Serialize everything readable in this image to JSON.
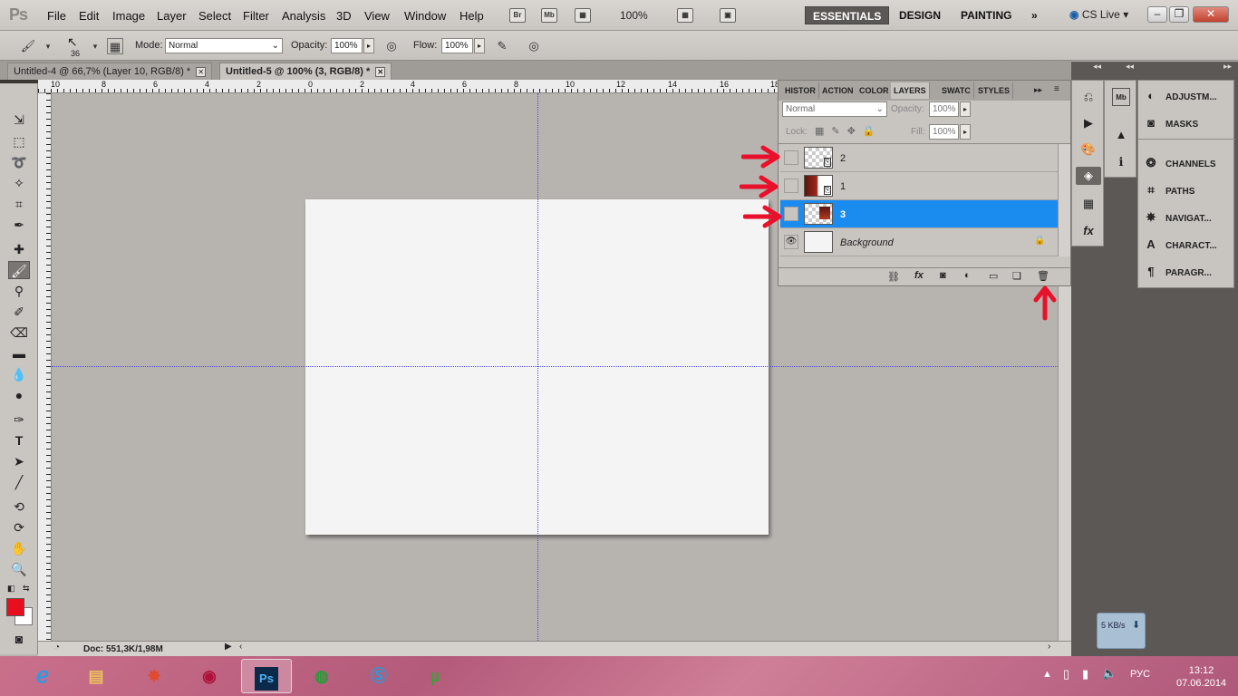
{
  "app": {
    "logo": "Ps"
  },
  "menubar": {
    "items": [
      "File",
      "Edit",
      "Image",
      "Layer",
      "Select",
      "Filter",
      "Analysis",
      "3D",
      "View",
      "Window",
      "Help"
    ],
    "bridge_icon": "Br",
    "minibridge_icon": "Mb",
    "zoom": "100%",
    "workspaces": [
      "ESSENTIALS",
      "DESIGN",
      "PAINTING"
    ],
    "more": "»",
    "cslive": "CS Live"
  },
  "options": {
    "brush_size": "36",
    "mode_label": "Mode:",
    "mode_value": "Normal",
    "opacity_label": "Opacity:",
    "opacity_value": "100%",
    "flow_label": "Flow:",
    "flow_value": "100%"
  },
  "tabs": [
    {
      "label": "Untitled-4 @ 66,7% (Layer 10, RGB/8) *"
    },
    {
      "label": "Untitled-5 @ 100% (3, RGB/8) *"
    }
  ],
  "ruler_ticks": [
    "10",
    "8",
    "6",
    "4",
    "2",
    "0",
    "2",
    "4",
    "6",
    "8",
    "10",
    "12",
    "14",
    "16",
    "18"
  ],
  "status": {
    "doc_size": "Doc: 551,3K/1,98M"
  },
  "layers_panel": {
    "tabs": [
      "HISTOR",
      "ACTION",
      "COLOR",
      "LAYERS",
      "SWATC",
      "STYLES"
    ],
    "blend_mode": "Normal",
    "opacity_label": "Opacity:",
    "opacity_value": "100%",
    "lock_label": "Lock:",
    "fill_label": "Fill:",
    "fill_value": "100%",
    "layers": [
      {
        "name": "2",
        "visible": false,
        "selected": false
      },
      {
        "name": "1",
        "visible": false,
        "selected": false
      },
      {
        "name": "3",
        "visible": false,
        "selected": true
      },
      {
        "name": "Background",
        "visible": true,
        "selected": false,
        "locked": true
      }
    ],
    "footer_icons": [
      "link-icon",
      "fx-icon",
      "mask-icon",
      "adjustment-icon",
      "group-folder-icon",
      "new-layer-icon",
      "trash-icon"
    ]
  },
  "dock": {
    "items": [
      "ADJUSTM...",
      "MASKS",
      "CHANNELS",
      "PATHS",
      "NAVIGAT...",
      "CHARACT...",
      "PARAGR..."
    ]
  },
  "net_widget": {
    "speed": "5 KB/s"
  },
  "taskbar": {
    "apps": [
      "internet-explorer",
      "file-explorer",
      "media-app",
      "remote-app",
      "photoshop",
      "chrome",
      "skype",
      "utorrent"
    ],
    "lang": "РУС",
    "time": "13:12",
    "date": "07.06.2014"
  },
  "colors": {
    "selection": "#1a8cf0",
    "annotation_arrow": "#e8102a",
    "fg_swatch": "#e8101e"
  }
}
